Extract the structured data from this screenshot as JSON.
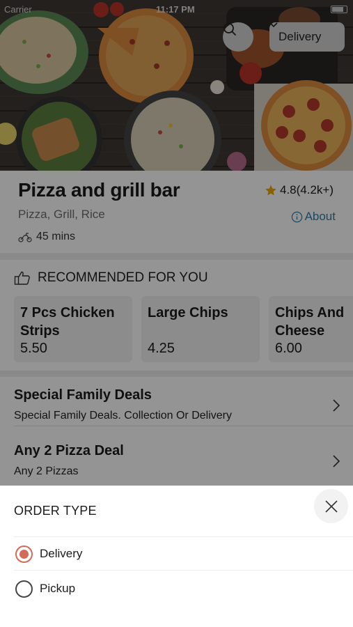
{
  "status_bar": {
    "carrier": "Carrier",
    "time": "11:17 PM"
  },
  "header": {
    "delivery_label": "Delivery",
    "search_icon": "search-icon",
    "chevron_icon": "chevron-down-icon"
  },
  "restaurant": {
    "name": "Pizza and grill bar",
    "rating": "4.8(4.2k+)",
    "cuisines": "Pizza, Grill, Rice",
    "about_label": "About",
    "eta": "45 mins"
  },
  "recommended": {
    "heading": "RECOMMENDED FOR YOU",
    "items": [
      {
        "name": "7 Pcs Chicken Strips",
        "price": "5.50"
      },
      {
        "name": "Large Chips",
        "price": "4.25"
      },
      {
        "name": "Chips And Cheese",
        "price": "6.00"
      }
    ]
  },
  "categories": [
    {
      "name": "Special Family Deals",
      "description": "Special Family Deals. Collection Or Delivery"
    },
    {
      "name": "Any 2 Pizza Deal",
      "description": "Any 2 Pizzas"
    }
  ],
  "order_sheet": {
    "title": "ORDER TYPE",
    "options": [
      {
        "label": "Delivery",
        "selected": true
      },
      {
        "label": "Pickup",
        "selected": false
      }
    ]
  },
  "colors": {
    "accent": "#d46a59",
    "link": "#2e7ea8",
    "star": "#f0a500"
  }
}
